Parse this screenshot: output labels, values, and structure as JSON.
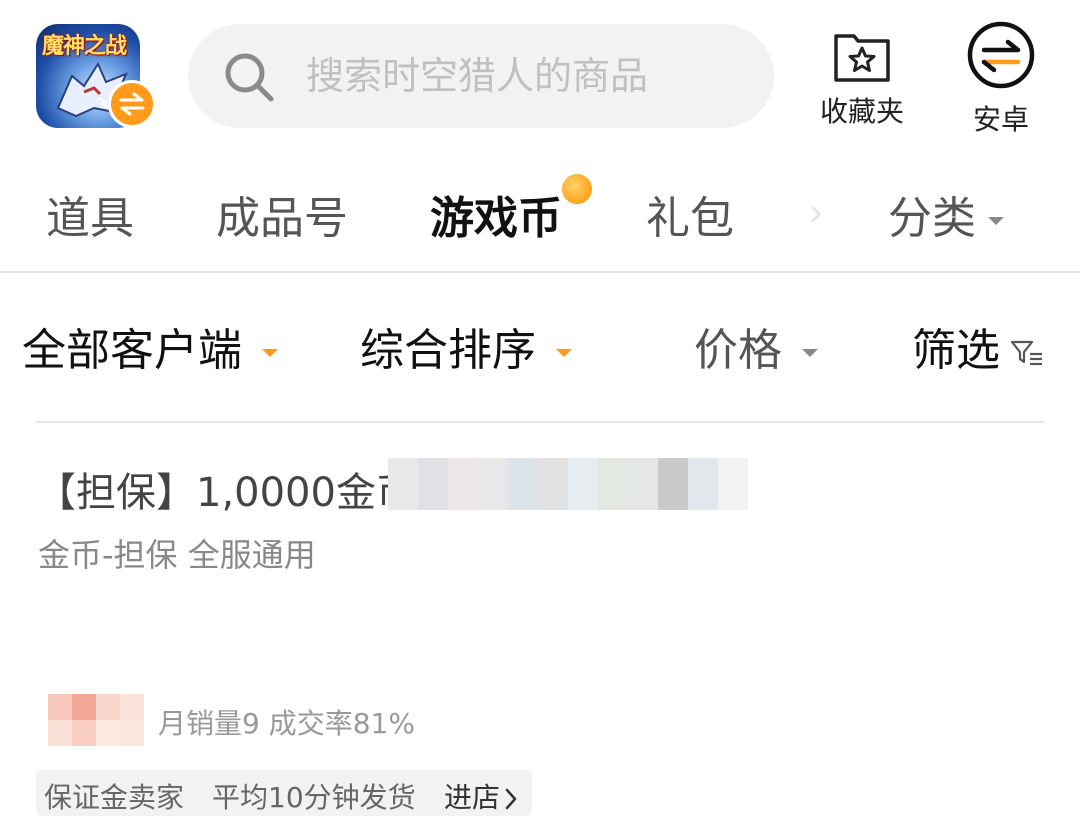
{
  "header": {
    "app_logo_text": "魔神之战",
    "search_placeholder": "搜索时空猎人的商品",
    "favorites_label": "收藏夹",
    "platform_label": "安卓"
  },
  "tabs": [
    {
      "label": "道具"
    },
    {
      "label": "成品号"
    },
    {
      "label": "游戏币",
      "active": true
    },
    {
      "label": "礼包"
    }
  ],
  "category_label": "分类",
  "filters": {
    "client": "全部客户端",
    "sort": "综合排序",
    "price": "价格",
    "filter": "筛选"
  },
  "listing": {
    "title": "【担保】1,0000金币",
    "subtitle": "金币-担保 全服通用",
    "sales_info": "月销量9 成交率81%",
    "tags": [
      "保证金卖家",
      "平均10分钟发货"
    ],
    "enter_store": "进店"
  },
  "colors": {
    "accent": "#ff9a1a",
    "search_bg": "#f2f2f2",
    "active_tab": "#111111",
    "inactive_tab": "#555555"
  }
}
